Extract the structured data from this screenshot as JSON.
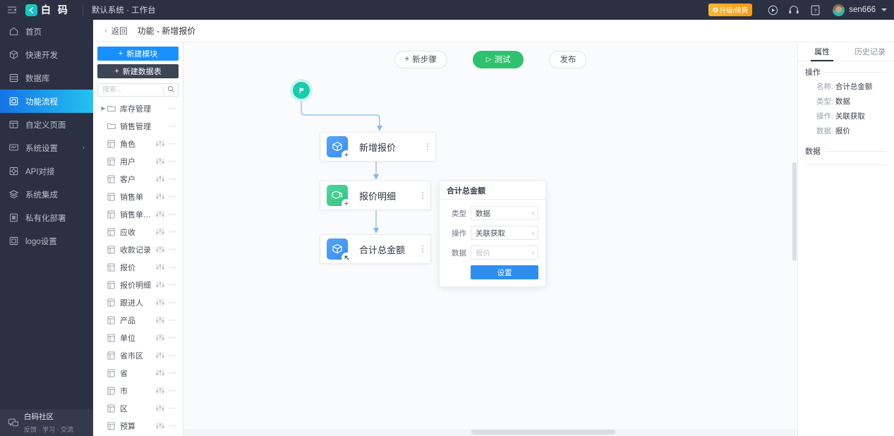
{
  "topbar": {
    "collapse_icon": "menu-collapse-icon",
    "logo_text": "白 码",
    "system_label": "默认系统 · 工作台",
    "upgrade_label": "升级/续费",
    "icons": [
      "play-circle-icon",
      "headset-icon",
      "help-book-icon"
    ],
    "username": "sen666"
  },
  "leftnav": {
    "items": [
      {
        "label": "首页",
        "icon": "home-icon",
        "active": false,
        "arrow": false
      },
      {
        "label": "快速开发",
        "icon": "cube-icon",
        "active": false,
        "arrow": false
      },
      {
        "label": "数据库",
        "icon": "database-icon",
        "active": false,
        "arrow": false
      },
      {
        "label": "功能流程",
        "icon": "flow-icon",
        "active": true,
        "arrow": false
      },
      {
        "label": "自定义页面",
        "icon": "layout-icon",
        "active": false,
        "arrow": false
      },
      {
        "label": "系统设置",
        "icon": "monitor-icon",
        "active": false,
        "arrow": true
      },
      {
        "label": "API对接",
        "icon": "api-icon",
        "active": false,
        "arrow": false
      },
      {
        "label": "系统集成",
        "icon": "layers-icon",
        "active": false,
        "arrow": false
      },
      {
        "label": "私有化部署",
        "icon": "server-icon",
        "active": false,
        "arrow": false
      },
      {
        "label": "logo设置",
        "icon": "image-icon",
        "active": false,
        "arrow": false
      }
    ],
    "bottom": {
      "title": "白码社区",
      "subtitle": "反馈 · 学习 · 交流",
      "icon": "community-icon"
    }
  },
  "subheader": {
    "back_label": "返回",
    "title": "功能 - 新增报价"
  },
  "tablepanel": {
    "new_module_label": "新建模块",
    "new_table_label": "新建数据表",
    "search_placeholder": "搜索...",
    "search_value": "",
    "tree": [
      {
        "label": "库存管理",
        "type": "folder",
        "caret": true
      },
      {
        "label": "销售管理",
        "type": "folder",
        "caret": false
      },
      {
        "label": "角色",
        "type": "table"
      },
      {
        "label": "用户",
        "type": "table"
      },
      {
        "label": "客户",
        "type": "table"
      },
      {
        "label": "销售单",
        "type": "table"
      },
      {
        "label": "销售单明细",
        "type": "table"
      },
      {
        "label": "应收",
        "type": "table"
      },
      {
        "label": "收款记录",
        "type": "table"
      },
      {
        "label": "报价",
        "type": "table"
      },
      {
        "label": "报价明细",
        "type": "table"
      },
      {
        "label": "跟进人",
        "type": "table"
      },
      {
        "label": "产品",
        "type": "table"
      },
      {
        "label": "单位",
        "type": "table"
      },
      {
        "label": "省市区",
        "type": "table"
      },
      {
        "label": "省",
        "type": "table"
      },
      {
        "label": "市",
        "type": "table"
      },
      {
        "label": "区",
        "type": "table"
      },
      {
        "label": "预算",
        "type": "table"
      }
    ]
  },
  "canvas": {
    "toolbar": {
      "add_step_label": "新步骤",
      "test_label": "测试",
      "publish_label": "发布"
    },
    "start_node": {
      "icon": "flag-icon"
    },
    "nodes": [
      {
        "label": "新增报价",
        "icon_color": "blue",
        "badge": "+"
      },
      {
        "label": "报价明细",
        "icon_color": "green",
        "badge": "+"
      },
      {
        "label": "合计总金额",
        "icon_color": "blue",
        "badge": "↖"
      }
    ],
    "popup": {
      "title": "合计总金额",
      "rows": [
        {
          "label": "类型",
          "value": "数据",
          "placeholder": false
        },
        {
          "label": "操作",
          "value": "关联获取",
          "placeholder": false
        },
        {
          "label": "数据",
          "value": "报价",
          "placeholder": true
        }
      ],
      "submit_label": "设置"
    }
  },
  "rightpanel": {
    "tabs": [
      {
        "label": "属性",
        "active": true
      },
      {
        "label": "历史记录",
        "active": false
      }
    ],
    "sections": [
      {
        "title": "操作",
        "fields": [
          {
            "key": "名称:",
            "value": "合计总金额"
          },
          {
            "key": "类型:",
            "value": "数据"
          },
          {
            "key": "操作:",
            "value": "关联获取"
          },
          {
            "key": "数据:",
            "value": "报价"
          }
        ]
      },
      {
        "title": "数据",
        "fields": []
      }
    ]
  },
  "colors": {
    "nav_bg": "#2b3142",
    "accent_blue": "#1890ff",
    "accent_green": "#2fc26e",
    "start_node": "#15cdae"
  }
}
